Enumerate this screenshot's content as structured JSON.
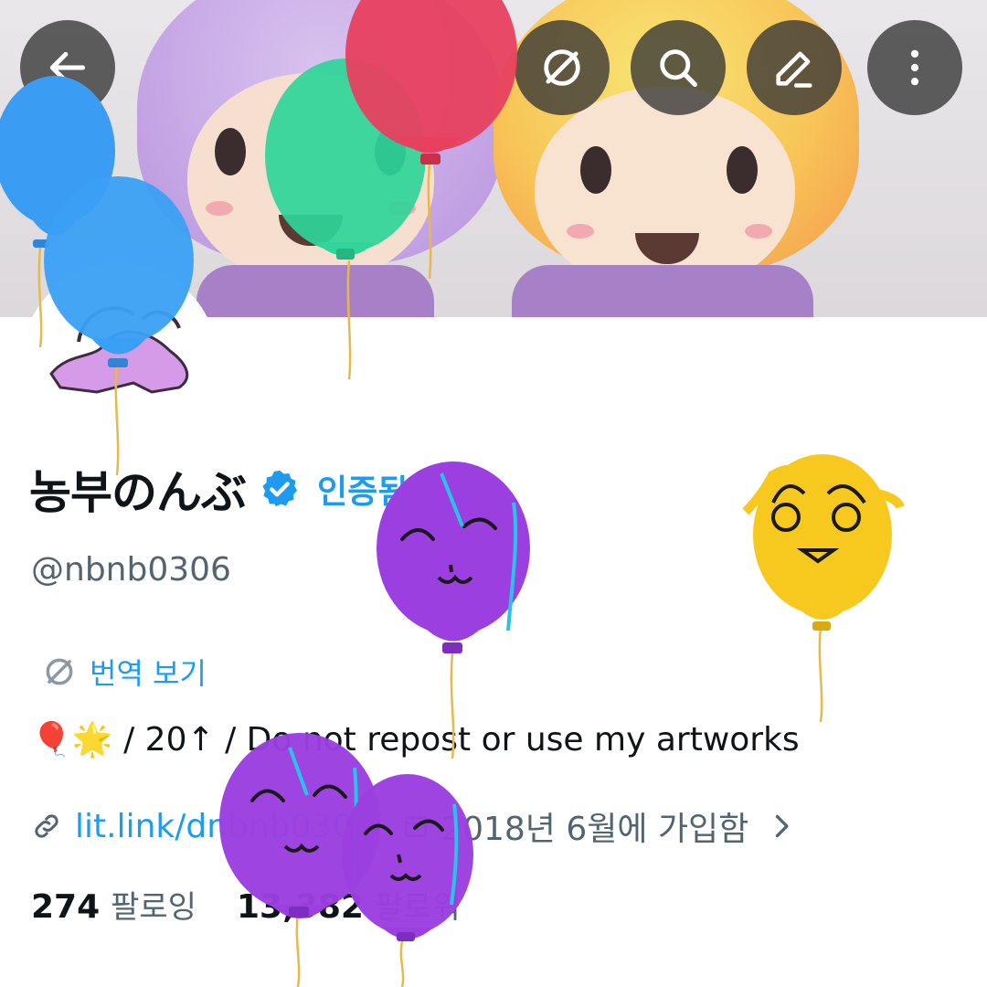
{
  "header": {
    "back_icon": "back-arrow-icon",
    "actions": [
      "translate-off-icon",
      "search-icon",
      "edit-icon",
      "more-vertical-icon"
    ]
  },
  "profile": {
    "display_name": "농부のんぶ",
    "verified_label": "인증됨",
    "handle": "@nbnb0306",
    "translate_label": "번역 보기",
    "bio": "🎈🌟 / 20↑ / Do not repost or use my artworks",
    "link": "lit.link/dnbnb0306",
    "joined": "2018년 6월에 가입함",
    "following_count": "274",
    "following_label": "팔로잉",
    "followers_count": "13,382",
    "followers_label": "팔로워"
  },
  "colors": {
    "accent": "#1d9bf0",
    "secondary_text": "#536471",
    "primary_text": "#0f1419",
    "balloon_blue": "#3a9cf2",
    "balloon_green": "#2fd59a",
    "balloon_red": "#e8405f",
    "balloon_purple": "#9b3fe0",
    "balloon_yellow": "#f7c81e"
  }
}
